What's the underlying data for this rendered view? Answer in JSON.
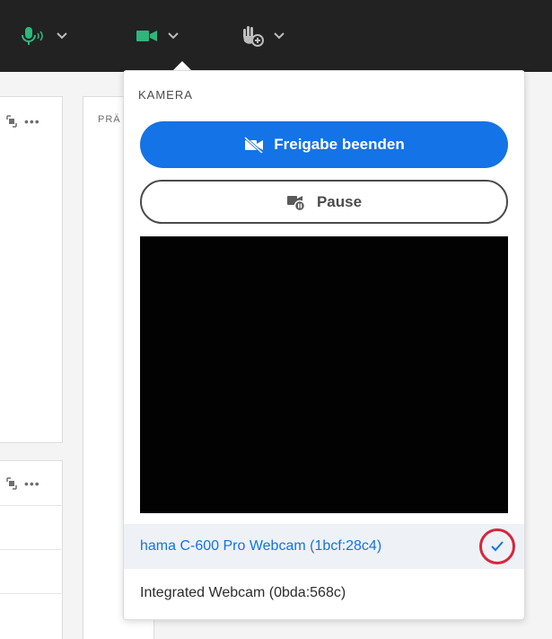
{
  "toolbar": {
    "mic_icon": "microphone-icon",
    "camera_icon": "camera-icon",
    "raise_hand_icon": "raise-hand-icon",
    "accent": "#2fb67c"
  },
  "background": {
    "panel_title": "PRÄ"
  },
  "popover": {
    "title": "KAMERA",
    "stop_sharing_label": "Freigabe beenden",
    "pause_label": "Pause",
    "devices": [
      {
        "label": "hama C-600 Pro Webcam (1bcf:28c4)",
        "selected": true
      },
      {
        "label": "Integrated Webcam (0bda:568c)",
        "selected": false
      }
    ]
  },
  "colors": {
    "primary": "#1473e6",
    "highlight_circle": "#d7263d",
    "toolbar_bg": "#222222"
  }
}
